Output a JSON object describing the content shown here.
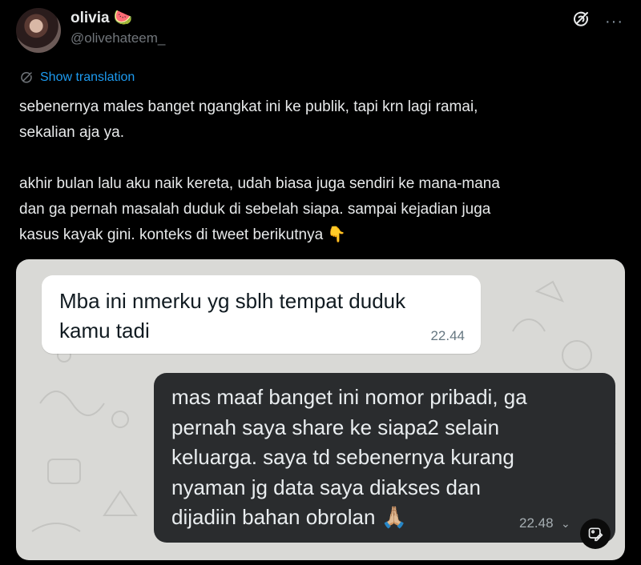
{
  "author": {
    "display_name": "olivia 🍉",
    "handle": "@olivehateem_"
  },
  "icons": {
    "grok": "grok-icon",
    "more": "more-icon",
    "translate": "translate-icon",
    "edit_media": "edit-image-icon"
  },
  "more_glyph": "···",
  "translate_label": "Show translation",
  "tweet_text": "sebenernya males banget ngangkat ini ke publik, tapi krn lagi ramai,\nsekalian aja ya.\n\nakhir bulan lalu aku naik kereta, udah biasa juga sendiri ke mana-mana\ndan ga pernah masalah duduk di sebelah siapa. sampai kejadian juga\nkasus kayak gini. konteks di tweet berikutnya 👇",
  "chat": {
    "incoming": {
      "text": "Mba ini nmerku yg sblh tempat duduk\nkamu tadi",
      "time": "22.44"
    },
    "outgoing": {
      "text": "mas maaf banget ini nomor pribadi, ga\npernah saya share ke siapa2 selain\nkeluarga. saya td sebenernya kurang\nnyaman jg data saya diakses dan\ndijadiin bahan obrolan 🙏🏼",
      "time": "22.48",
      "status_glyph": "⌄"
    }
  },
  "colors": {
    "background": "#000000",
    "link": "#1d9bf0",
    "muted": "#71767b",
    "chat_bg": "#d9d9d6",
    "incoming_bubble": "#ffffff",
    "outgoing_bubble": "#2a2c2e"
  }
}
